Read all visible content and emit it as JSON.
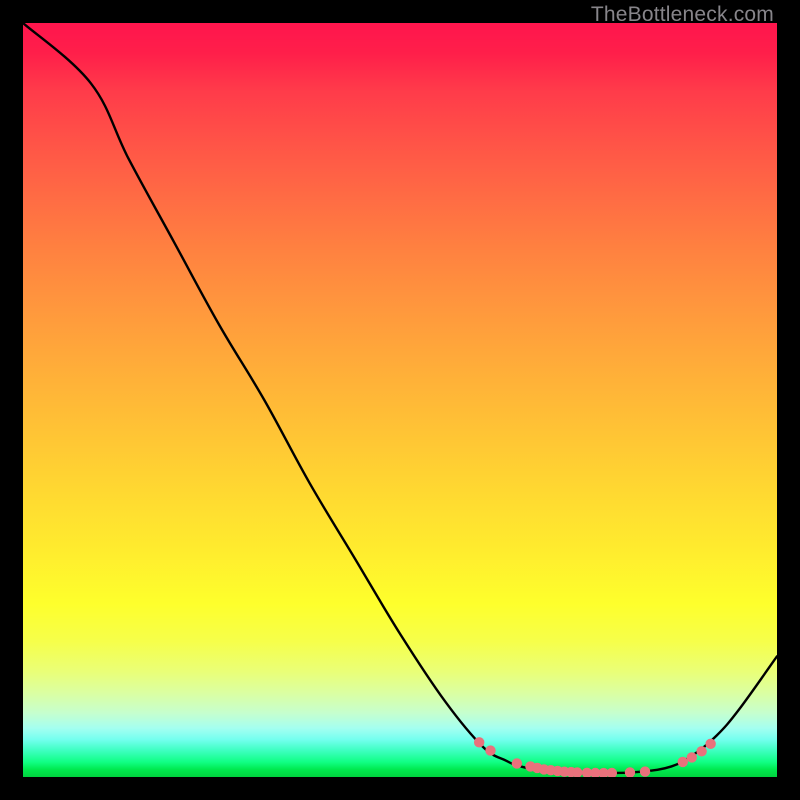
{
  "watermark": "TheBottleneck.com",
  "chart_data": {
    "type": "line",
    "title": "",
    "xlabel": "",
    "ylabel": "",
    "xlim": [
      0,
      100
    ],
    "ylim": [
      0,
      100
    ],
    "series": [
      {
        "name": "curve",
        "x": [
          0,
          9,
          14,
          20,
          26,
          32,
          38,
          44,
          50,
          56,
          61,
          64,
          66,
          69,
          72,
          77,
          82,
          86,
          89,
          92,
          95,
          100
        ],
        "y": [
          100,
          92,
          82,
          71,
          60,
          50,
          39,
          29,
          19,
          10,
          4,
          2.2,
          1.4,
          0.8,
          0.5,
          0.5,
          0.7,
          1.4,
          3.0,
          5.5,
          9.0,
          16
        ]
      }
    ],
    "markers": {
      "name": "optimum-dots",
      "x": [
        60.5,
        62.0,
        65.5,
        67.3,
        68.2,
        69.1,
        70.0,
        70.9,
        71.8,
        72.7,
        73.5,
        74.8,
        75.9,
        77.0,
        78.1,
        80.5,
        82.5,
        87.5,
        88.7,
        90.0,
        91.2
      ],
      "y": [
        4.6,
        3.5,
        1.8,
        1.4,
        1.2,
        1.0,
        0.9,
        0.8,
        0.7,
        0.65,
        0.6,
        0.56,
        0.53,
        0.52,
        0.53,
        0.6,
        0.72,
        2.0,
        2.6,
        3.4,
        4.4
      ]
    },
    "colors": {
      "marker": "#e9717c",
      "line": "#000000"
    }
  }
}
